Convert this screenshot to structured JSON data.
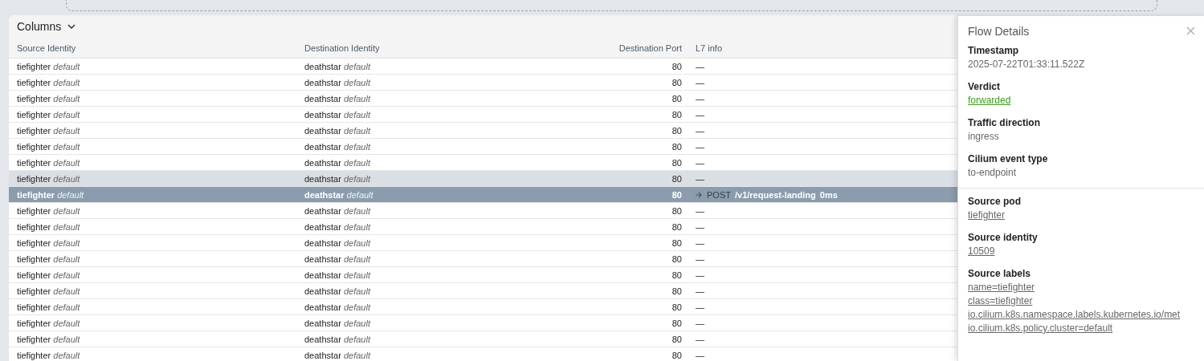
{
  "toolbar": {
    "columns_button": "Columns"
  },
  "table": {
    "columns": [
      "Source Identity",
      "Destination Identity",
      "Destination Port",
      "L7 info"
    ],
    "rows": [
      {
        "source": "tiefighter",
        "source_ns": "default",
        "destination": "deathstar",
        "destination_ns": "default",
        "port": "80",
        "l7": {
          "kind": "none",
          "text": "—"
        },
        "hovered": false,
        "selected": false
      },
      {
        "source": "tiefighter",
        "source_ns": "default",
        "destination": "deathstar",
        "destination_ns": "default",
        "port": "80",
        "l7": {
          "kind": "none",
          "text": "—"
        },
        "hovered": false,
        "selected": false
      },
      {
        "source": "tiefighter",
        "source_ns": "default",
        "destination": "deathstar",
        "destination_ns": "default",
        "port": "80",
        "l7": {
          "kind": "none",
          "text": "—"
        },
        "hovered": false,
        "selected": false
      },
      {
        "source": "tiefighter",
        "source_ns": "default",
        "destination": "deathstar",
        "destination_ns": "default",
        "port": "80",
        "l7": {
          "kind": "none",
          "text": "—"
        },
        "hovered": false,
        "selected": false
      },
      {
        "source": "tiefighter",
        "source_ns": "default",
        "destination": "deathstar",
        "destination_ns": "default",
        "port": "80",
        "l7": {
          "kind": "none",
          "text": "—"
        },
        "hovered": false,
        "selected": false
      },
      {
        "source": "tiefighter",
        "source_ns": "default",
        "destination": "deathstar",
        "destination_ns": "default",
        "port": "80",
        "l7": {
          "kind": "none",
          "text": "—"
        },
        "hovered": false,
        "selected": false
      },
      {
        "source": "tiefighter",
        "source_ns": "default",
        "destination": "deathstar",
        "destination_ns": "default",
        "port": "80",
        "l7": {
          "kind": "none",
          "text": "—"
        },
        "hovered": false,
        "selected": false
      },
      {
        "source": "tiefighter",
        "source_ns": "default",
        "destination": "deathstar",
        "destination_ns": "default",
        "port": "80",
        "l7": {
          "kind": "none",
          "text": "—"
        },
        "hovered": true,
        "selected": false
      },
      {
        "source": "tiefighter",
        "source_ns": "default",
        "destination": "deathstar",
        "destination_ns": "default",
        "port": "80",
        "l7": {
          "kind": "http",
          "method": "POST",
          "path": "/v1/request-landing",
          "latency": "0ms"
        },
        "hovered": false,
        "selected": true
      },
      {
        "source": "tiefighter",
        "source_ns": "default",
        "destination": "deathstar",
        "destination_ns": "default",
        "port": "80",
        "l7": {
          "kind": "none",
          "text": "—"
        },
        "hovered": false,
        "selected": false
      },
      {
        "source": "tiefighter",
        "source_ns": "default",
        "destination": "deathstar",
        "destination_ns": "default",
        "port": "80",
        "l7": {
          "kind": "none",
          "text": "—"
        },
        "hovered": false,
        "selected": false
      },
      {
        "source": "tiefighter",
        "source_ns": "default",
        "destination": "deathstar",
        "destination_ns": "default",
        "port": "80",
        "l7": {
          "kind": "none",
          "text": "—"
        },
        "hovered": false,
        "selected": false
      },
      {
        "source": "tiefighter",
        "source_ns": "default",
        "destination": "deathstar",
        "destination_ns": "default",
        "port": "80",
        "l7": {
          "kind": "none",
          "text": "—"
        },
        "hovered": false,
        "selected": false
      },
      {
        "source": "tiefighter",
        "source_ns": "default",
        "destination": "deathstar",
        "destination_ns": "default",
        "port": "80",
        "l7": {
          "kind": "none",
          "text": "—"
        },
        "hovered": false,
        "selected": false
      },
      {
        "source": "tiefighter",
        "source_ns": "default",
        "destination": "deathstar",
        "destination_ns": "default",
        "port": "80",
        "l7": {
          "kind": "none",
          "text": "—"
        },
        "hovered": false,
        "selected": false
      },
      {
        "source": "tiefighter",
        "source_ns": "default",
        "destination": "deathstar",
        "destination_ns": "default",
        "port": "80",
        "l7": {
          "kind": "none",
          "text": "—"
        },
        "hovered": false,
        "selected": false
      },
      {
        "source": "tiefighter",
        "source_ns": "default",
        "destination": "deathstar",
        "destination_ns": "default",
        "port": "80",
        "l7": {
          "kind": "none",
          "text": "—"
        },
        "hovered": false,
        "selected": false
      },
      {
        "source": "tiefighter",
        "source_ns": "default",
        "destination": "deathstar",
        "destination_ns": "default",
        "port": "80",
        "l7": {
          "kind": "none",
          "text": "—"
        },
        "hovered": false,
        "selected": false
      },
      {
        "source": "tiefighter",
        "source_ns": "default",
        "destination": "deathstar",
        "destination_ns": "default",
        "port": "80",
        "l7": {
          "kind": "none",
          "text": "—"
        },
        "hovered": false,
        "selected": false
      }
    ]
  },
  "flow_details": {
    "title": "Flow Details",
    "sections": [
      [
        {
          "label": "Timestamp",
          "values": [
            {
              "kind": "text",
              "text": "2025-07-22T01:33:11.522Z"
            }
          ]
        },
        {
          "label": "Verdict",
          "values": [
            {
              "kind": "verdict",
              "text": "forwarded"
            }
          ]
        },
        {
          "label": "Traffic direction",
          "values": [
            {
              "kind": "text",
              "text": "ingress"
            }
          ]
        },
        {
          "label": "Cilium event type",
          "values": [
            {
              "kind": "text",
              "text": "to-endpoint"
            }
          ]
        }
      ],
      [
        {
          "label": "Source pod",
          "values": [
            {
              "kind": "link",
              "text": "tiefighter"
            }
          ]
        },
        {
          "label": "Source identity",
          "values": [
            {
              "kind": "link",
              "text": "10509"
            }
          ]
        },
        {
          "label": "Source labels",
          "values": [
            {
              "kind": "link",
              "text": "name=tiefighter"
            },
            {
              "kind": "link",
              "text": "class=tiefighter"
            },
            {
              "kind": "link",
              "text": "io.cilium.k8s.namespace.labels.kubernetes.io/met"
            },
            {
              "kind": "link",
              "text": "io.cilium.k8s.policy.cluster=default"
            }
          ]
        }
      ]
    ]
  }
}
